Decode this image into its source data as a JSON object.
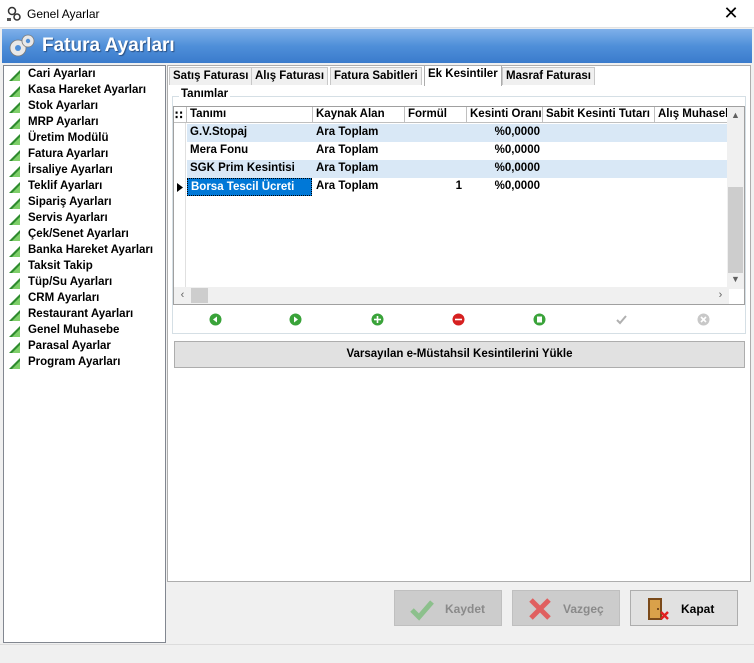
{
  "window": {
    "title": "Genel Ayarlar",
    "close_glyph": "✕"
  },
  "header": {
    "title": "Fatura Ayarları",
    "icon": "gears-icon"
  },
  "sidebar": {
    "items": [
      {
        "label": "Cari Ayarları"
      },
      {
        "label": "Kasa Hareket Ayarları"
      },
      {
        "label": "Stok Ayarları"
      },
      {
        "label": "MRP Ayarları"
      },
      {
        "label": "Üretim Modülü"
      },
      {
        "label": "Fatura Ayarları"
      },
      {
        "label": "İrsaliye Ayarları"
      },
      {
        "label": "Teklif Ayarları"
      },
      {
        "label": "Sipariş Ayarları"
      },
      {
        "label": "Servis Ayarları"
      },
      {
        "label": "Çek/Senet Ayarları"
      },
      {
        "label": "Banka Hareket Ayarları"
      },
      {
        "label": "Taksit Takip"
      },
      {
        "label": "Tüp/Su Ayarları"
      },
      {
        "label": "CRM Ayarları"
      },
      {
        "label": "Restaurant Ayarları"
      },
      {
        "label": "Genel Muhasebe"
      },
      {
        "label": "Parasal Ayarlar"
      },
      {
        "label": "Program Ayarları"
      }
    ]
  },
  "tabs": [
    {
      "label": "Satış Faturası"
    },
    {
      "label": "Alış Faturası"
    },
    {
      "label": "Fatura Sabitleri"
    },
    {
      "label": "Ek Kesintiler",
      "active": true
    },
    {
      "label": "Masraf Faturası"
    }
  ],
  "group": {
    "label": "Tanımlar"
  },
  "grid": {
    "corner": "∷",
    "columns": [
      "Tanımı",
      "Kaynak Alan",
      "Formül",
      "Kesinti Oranı",
      "Sabit Kesinti Tutarı",
      "Alış Muhaseb"
    ],
    "rows": [
      [
        "G.V.Stopaj",
        "Ara Toplam",
        "",
        "%0,0000",
        "",
        ""
      ],
      [
        "Mera Fonu",
        "Ara Toplam",
        "",
        "%0,0000",
        "",
        ""
      ],
      [
        "SGK Prim Kesintisi",
        "Ara Toplam",
        "",
        "%0,0000",
        "",
        ""
      ],
      [
        "Borsa Tescil Ücreti",
        "Ara Toplam",
        "1",
        "%0,0000",
        "",
        ""
      ]
    ],
    "selected_row": 3
  },
  "load_button": {
    "label": "Varsayılan e-Müstahsil Kesintilerini Yükle"
  },
  "footer": {
    "save_label": "Kaydet",
    "cancel_label": "Vazgeç",
    "close_label": "Kapat"
  },
  "colors": {
    "header_blue": "#4f8fd9",
    "row_alt": "#d9e8f6",
    "selection": "#0078d7"
  }
}
